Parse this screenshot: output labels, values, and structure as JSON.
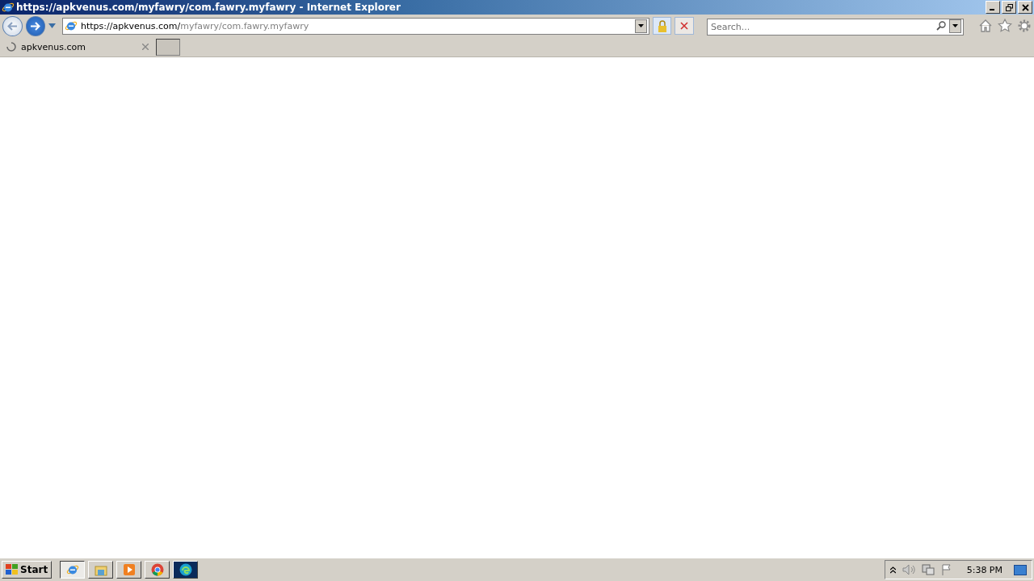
{
  "window": {
    "title": "https://apkvenus.com/myfawry/com.fawry.myfawry - Internet Explorer"
  },
  "address": {
    "host": "https://apkvenus.com/",
    "path": "myfawry/com.fawry.myfawry"
  },
  "search": {
    "placeholder": "Search..."
  },
  "tabs": [
    {
      "label": "apkvenus.com",
      "selected": true,
      "loading": true
    }
  ],
  "taskbar": {
    "start": "Start",
    "apps": [
      {
        "kind": "ie",
        "selected": true
      },
      {
        "kind": "explorer",
        "selected": false
      },
      {
        "kind": "media",
        "selected": false
      },
      {
        "kind": "chrome",
        "selected": false
      },
      {
        "kind": "edge",
        "selected": false
      }
    ],
    "clock": "5:38 PM"
  }
}
